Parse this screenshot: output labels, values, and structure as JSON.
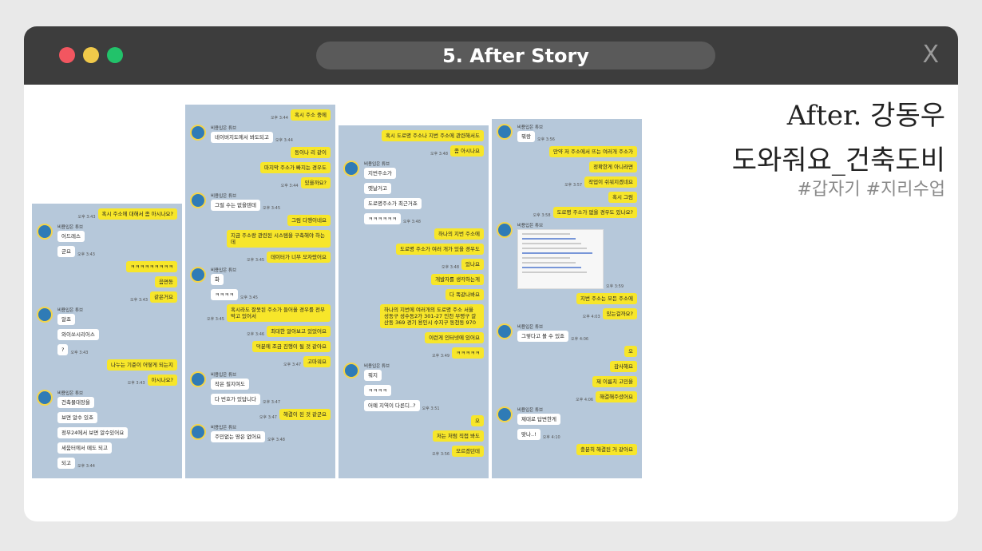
{
  "window": {
    "title": "5. After Story",
    "close_label": "X",
    "heading_line1": "After. 강동우",
    "heading_line2": "도와줘요_건축도비",
    "tags": "#갑자기 #지리수업"
  },
  "colors": {
    "titlebar": "#3d3d3d",
    "my_bubble": "#f7e62a",
    "chat_bg": "#b6c8da"
  },
  "panels": [
    {
      "sender": "비용입은 튜브",
      "messages": [
        {
          "side": "me",
          "text": "혹시 주소에 대해서 좀 아시나요?",
          "time": "오후 3:43"
        },
        {
          "side": "other",
          "text": "어드레스",
          "name": true
        },
        {
          "side": "other",
          "text": "군요",
          "time": "오후 3:43"
        },
        {
          "side": "me",
          "text": "ㅋㅋㅋㅋㅋㅋㅋㅋㅋ"
        },
        {
          "side": "me",
          "text": "음면동"
        },
        {
          "side": "me",
          "text": "같은거요",
          "time": "오후 3:43"
        },
        {
          "side": "other",
          "text": "알죠",
          "name": true
        },
        {
          "side": "other",
          "text": "와이쏘시리어스"
        },
        {
          "side": "other",
          "text": "?",
          "time": "오후 3:43"
        },
        {
          "side": "me",
          "text": "나누는 기준이 어떻게 되는지"
        },
        {
          "side": "me",
          "text": "아시나요?",
          "time": "오후 3:43"
        },
        {
          "side": "other",
          "text": "건축물대장을",
          "name": true
        },
        {
          "side": "other",
          "text": "보면 알수 있죠"
        },
        {
          "side": "other",
          "text": "정부24에서 보면 알수있어요"
        },
        {
          "side": "other",
          "text": "세움터에서 떼도 되고"
        },
        {
          "side": "other",
          "text": "되고",
          "time": "오후 3:44"
        }
      ]
    },
    {
      "sender": "비용입은 튜브",
      "messages": [
        {
          "side": "me",
          "text": "혹시 주소 중에",
          "time": "오후 3:44"
        },
        {
          "side": "other",
          "text": "네이버지도에서 봐도되고",
          "time": "오후 3:44",
          "name": true
        },
        {
          "side": "me",
          "text": "동이나 리 같이"
        },
        {
          "side": "me",
          "text": "마지막 주소가 빠지는 경우도"
        },
        {
          "side": "me",
          "text": "있을까요?",
          "time": "오후 3:44"
        },
        {
          "side": "other",
          "text": "그럴 수는 없을텐데",
          "time": "오후 3:45",
          "name": true
        },
        {
          "side": "me",
          "text": "그럼 다행이네요"
        },
        {
          "side": "me",
          "text": "지금 주소랑 관련된 시스템을 구축해야 하는데"
        },
        {
          "side": "me",
          "text": "데이터가 너무 모자랐어요",
          "time": "오후 3:45"
        },
        {
          "side": "other",
          "text": "화",
          "name": true
        },
        {
          "side": "other",
          "text": "ㅋㅋㅋㅋ",
          "time": "오후 3:45"
        },
        {
          "side": "me",
          "text": "혹시라도 잘못된 주소가 들어올 경우를 전부 막고 있어서",
          "time": "오후 3:45"
        },
        {
          "side": "me",
          "text": "최대한 알아보고 있었어요",
          "time": "오후 3:46"
        },
        {
          "side": "me",
          "text": "덕분에 조금 진행이 될 것 같아요"
        },
        {
          "side": "me",
          "text": "고마워요",
          "time": "오후 3:47"
        },
        {
          "side": "other",
          "text": "작은 필지여도",
          "name": true
        },
        {
          "side": "other",
          "text": "다 번호가 있답니다",
          "time": "오후 3:47"
        },
        {
          "side": "me",
          "text": "해결이 된 것 같군요",
          "time": "오후 3:47"
        },
        {
          "side": "other",
          "text": "주민없는 땅은 없어요",
          "time": "오후 3:48",
          "name": true
        }
      ]
    },
    {
      "sender": "비용입은 튜브",
      "messages": [
        {
          "side": "me",
          "text": "혹시 도로명 주소나 지번 주소에 관련해서도"
        },
        {
          "side": "me",
          "text": "좀 아시나요",
          "time": "오후 3:48"
        },
        {
          "side": "other",
          "text": "지번주소가",
          "name": true
        },
        {
          "side": "other",
          "text": "옛날거고"
        },
        {
          "side": "other",
          "text": "도로명주소가 최근거죠"
        },
        {
          "side": "other",
          "text": "ㅋㅋㅋㅋㅋㅋ",
          "time": "오후 3:48"
        },
        {
          "side": "me",
          "text": "하나의 지번 주소에"
        },
        {
          "side": "me",
          "text": "도로명 주소가 여러 개가 있을 경우도"
        },
        {
          "side": "me",
          "text": "있나요",
          "time": "오후 3:48"
        },
        {
          "side": "me",
          "text": "개발자를 생각하는게"
        },
        {
          "side": "me",
          "text": "다 똑같나봐요"
        },
        {
          "side": "me",
          "text": "하나의 지번에 여러개의 도로명 주소 서울 성동구 성수동2가 301-27 인천 부평구 갈산동 369 경기 용인시 수지구 동천동 970"
        },
        {
          "side": "me",
          "text": "이런게 인터넷에 있어요"
        },
        {
          "side": "me",
          "text": "ㅋㅋㅋㅋㅋ",
          "time": "오후 3:49"
        },
        {
          "side": "other",
          "text": "뭐지",
          "name": true
        },
        {
          "side": "other",
          "text": "ㅋㅋㅋㅋ"
        },
        {
          "side": "other",
          "text": "어예 지역이 다른디..?",
          "time": "오후 3:51"
        },
        {
          "side": "me",
          "text": "오"
        },
        {
          "side": "me",
          "text": "저는 처럼 직접 봐도"
        },
        {
          "side": "me",
          "text": "모르겠던데",
          "time": "오후 3:56"
        }
      ]
    },
    {
      "sender": "비용입은 튜브",
      "messages": [
        {
          "side": "other",
          "text": "뭐랑",
          "time": "오후 3:56",
          "name": true
        },
        {
          "side": "me",
          "text": "만약 저 주소에서 뜨는 여러개 주소가"
        },
        {
          "side": "me",
          "text": "정확한게 아니라면"
        },
        {
          "side": "me",
          "text": "작업이 쉬워지겠네요",
          "time": "오후 3:57"
        },
        {
          "side": "me",
          "text": "혹시 그럼"
        },
        {
          "side": "me",
          "text": "도로명 주소가 없을 경우도 있나요?",
          "time": "오후 3:58"
        },
        {
          "side": "other",
          "text": "[screenshot]",
          "time": "오후 3:59",
          "name": true,
          "shot": true
        },
        {
          "side": "me",
          "text": "지번 주소는 모든 주소에"
        },
        {
          "side": "me",
          "text": "있는걸까요?",
          "time": "오후 4:03"
        },
        {
          "side": "other",
          "text": "그렇다고 볼 수 있죠",
          "time": "오후 4:06",
          "name": true
        },
        {
          "side": "me",
          "text": "오"
        },
        {
          "side": "me",
          "text": "감사해요"
        },
        {
          "side": "me",
          "text": "제 이름치 고민을"
        },
        {
          "side": "me",
          "text": "해결해주셨어요",
          "time": "오후 4:06"
        },
        {
          "side": "other",
          "text": "제대로 답변한게",
          "name": true
        },
        {
          "side": "other",
          "text": "맞나..!",
          "time": "오후 4:10"
        },
        {
          "side": "me",
          "text": "충분히 해결된 거 같아요"
        }
      ]
    }
  ]
}
